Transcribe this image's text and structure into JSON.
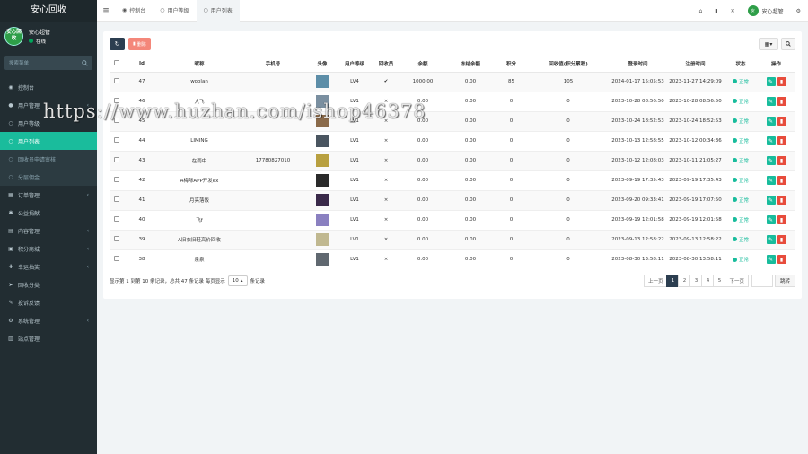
{
  "sidebar": {
    "brand": "安心回收",
    "user": {
      "avatar_text": "安心回收",
      "name": "安心超管",
      "status": "在线"
    },
    "search_placeholder": "搜索菜单",
    "items": [
      {
        "label": "控制台",
        "icon": "dashboard-icon",
        "glyph": "◉",
        "chev": false,
        "state": "normal"
      },
      {
        "label": "用户管理",
        "icon": "user-icon",
        "glyph": "●",
        "chev": true,
        "state": "normal"
      },
      {
        "label": "用户等级",
        "icon": "circle-icon",
        "glyph": "○",
        "chev": false,
        "state": "normal"
      },
      {
        "label": "用户列表",
        "icon": "circle-icon",
        "glyph": "○",
        "chev": false,
        "state": "active"
      },
      {
        "label": "回收员申请审核",
        "icon": "circle-icon",
        "glyph": "○",
        "chev": false,
        "state": "sub"
      },
      {
        "label": "分层佣金",
        "icon": "circle-icon",
        "glyph": "○",
        "chev": false,
        "state": "sub"
      },
      {
        "label": "订单管理",
        "icon": "order-icon",
        "glyph": "▦",
        "chev": true,
        "state": "normal"
      },
      {
        "label": "公益捐献",
        "icon": "gear-icon",
        "glyph": "✱",
        "chev": false,
        "state": "normal"
      },
      {
        "label": "内容管理",
        "icon": "content-icon",
        "glyph": "▤",
        "chev": true,
        "state": "normal"
      },
      {
        "label": "积分商城",
        "icon": "shop-icon",
        "glyph": "▣",
        "chev": true,
        "state": "normal"
      },
      {
        "label": "幸运抽奖",
        "icon": "gift-icon",
        "glyph": "✚",
        "chev": true,
        "state": "normal"
      },
      {
        "label": "回收分类",
        "icon": "send-icon",
        "glyph": "➤",
        "chev": false,
        "state": "normal"
      },
      {
        "label": "投诉反馈",
        "icon": "feedback-icon",
        "glyph": "✎",
        "chev": false,
        "state": "normal"
      },
      {
        "label": "系统管理",
        "icon": "settings-icon",
        "glyph": "⚙",
        "chev": true,
        "state": "normal"
      },
      {
        "label": "站点管理",
        "icon": "site-icon",
        "glyph": "▥",
        "chev": false,
        "state": "normal"
      }
    ]
  },
  "topbar": {
    "tabs": [
      {
        "label": "控制台",
        "icon": "dashboard-icon",
        "glyph": "◉",
        "active": false
      },
      {
        "label": "用户等级",
        "icon": "circle-icon",
        "glyph": "○",
        "active": false
      },
      {
        "label": "用户列表",
        "icon": "circle-icon",
        "glyph": "○",
        "active": true
      }
    ],
    "user_name": "安心超管"
  },
  "table": {
    "headers": [
      "Id",
      "昵称",
      "手机号",
      "头像",
      "用户等级",
      "回收员",
      "余额",
      "冻结余额",
      "积分",
      "回收值(积分累积)",
      "登录时间",
      "注册时间",
      "状态",
      "操作"
    ],
    "rows": [
      {
        "id": "47",
        "nickname": "woolan",
        "phone": "",
        "avatar_color": "#5d8ea8",
        "level": "LV4",
        "recycler": "✔",
        "balance": "1000.00",
        "frozen": "0.00",
        "points": "85",
        "recycle": "105",
        "login": "2024-01-17 15:05:53",
        "register": "2023-11-27 14:29:09",
        "status": "正常"
      },
      {
        "id": "46",
        "nickname": "大飞",
        "phone": "",
        "avatar_color": "#7a8fa0",
        "level": "LV1",
        "recycler": "×",
        "balance": "0.00",
        "frozen": "0.00",
        "points": "0",
        "recycle": "0",
        "login": "2023-10-28 08:56:50",
        "register": "2023-10-28 08:56:50",
        "status": "正常"
      },
      {
        "id": "45",
        "nickname": "",
        "phone": "",
        "avatar_color": "#8a6a4a",
        "level": "LV1",
        "recycler": "×",
        "balance": "0.00",
        "frozen": "0.00",
        "points": "0",
        "recycle": "0",
        "login": "2023-10-24 18:52:53",
        "register": "2023-10-24 18:52:53",
        "status": "正常"
      },
      {
        "id": "44",
        "nickname": "LIMING",
        "phone": "",
        "avatar_color": "#4a5560",
        "level": "LV1",
        "recycler": "×",
        "balance": "0.00",
        "frozen": "0.00",
        "points": "0",
        "recycle": "0",
        "login": "2023-10-13 12:58:55",
        "register": "2023-10-12 00:34:36",
        "status": "正常"
      },
      {
        "id": "43",
        "nickname": "在雨中",
        "phone": "17780827010",
        "avatar_color": "#b8a040",
        "level": "LV1",
        "recycler": "×",
        "balance": "0.00",
        "frozen": "0.00",
        "points": "0",
        "recycle": "0",
        "login": "2023-10-12 12:08:03",
        "register": "2023-10-11 21:05:27",
        "status": "正常"
      },
      {
        "id": "42",
        "nickname": "A梅际APP开发ex",
        "phone": "",
        "avatar_color": "#2a2a2a",
        "level": "LV1",
        "recycler": "×",
        "balance": "0.00",
        "frozen": "0.00",
        "points": "0",
        "recycle": "0",
        "login": "2023-09-19 17:35:43",
        "register": "2023-09-19 17:35:43",
        "status": "正常"
      },
      {
        "id": "41",
        "nickname": "月亮落饭",
        "phone": "",
        "avatar_color": "#3a2a4a",
        "level": "LV1",
        "recycler": "×",
        "balance": "0.00",
        "frozen": "0.00",
        "points": "0",
        "recycle": "0",
        "login": "2023-09-20 09:33:41",
        "register": "2023-09-19 17:07:50",
        "status": "正常"
      },
      {
        "id": "40",
        "nickname": "飞f",
        "phone": "",
        "avatar_color": "#8a80c0",
        "level": "LV1",
        "recycler": "×",
        "balance": "0.00",
        "frozen": "0.00",
        "points": "0",
        "recycle": "0",
        "login": "2023-09-19 12:01:58",
        "register": "2023-09-19 12:01:58",
        "status": "正常"
      },
      {
        "id": "39",
        "nickname": "A旧衣旧鞋高价回收",
        "phone": "",
        "avatar_color": "#c0b890",
        "level": "LV1",
        "recycler": "×",
        "balance": "0.00",
        "frozen": "0.00",
        "points": "0",
        "recycle": "0",
        "login": "2023-09-13 12:58:22",
        "register": "2023-09-13 12:58:22",
        "status": "正常"
      },
      {
        "id": "38",
        "nickname": "泉泉",
        "phone": "",
        "avatar_color": "#606870",
        "level": "LV1",
        "recycler": "×",
        "balance": "0.00",
        "frozen": "0.00",
        "points": "0",
        "recycle": "0",
        "login": "2023-08-30 13:58:11",
        "register": "2023-08-30 13:58:11",
        "status": "正常"
      }
    ]
  },
  "toolbar": {
    "delete_label": "删除"
  },
  "pagination": {
    "info_prefix": "显示第 1 到第 10 条记录，总共 47 条记录 每页显示",
    "page_size": "10",
    "info_suffix": "条记录",
    "prev": "上一页",
    "pages": [
      "1",
      "2",
      "3",
      "4",
      "5"
    ],
    "current": "1",
    "next": "下一页",
    "go": "跳转"
  },
  "watermark": "https://www.huzhan.com/ishop46378",
  "colors": {
    "accent": "#1abc9c",
    "sidebar_bg": "#222d32",
    "danger": "#e74c3c",
    "primary_dark": "#2c3e50"
  }
}
